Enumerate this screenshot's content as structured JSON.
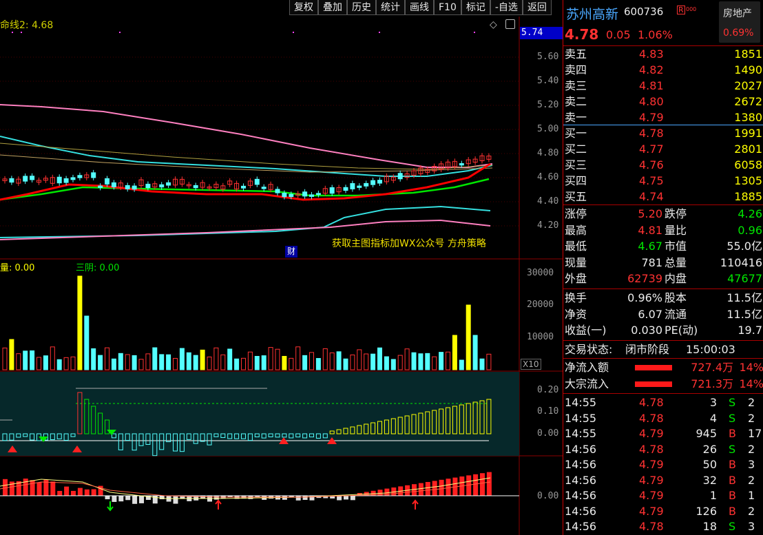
{
  "toolbar": [
    "复权",
    "叠加",
    "历史",
    "统计",
    "画线",
    "F10",
    "标记",
    "-自选",
    "返回"
  ],
  "main_chart": {
    "indicator_label": "命线2: 4.68",
    "current_price_tag": "5.74",
    "y_ticks": [
      "5.60",
      "5.40",
      "5.20",
      "5.00",
      "4.80",
      "4.60",
      "4.40",
      "4.20"
    ],
    "promo_text": "获取主图指标加WX公众号 方舟策略",
    "finance_marker": "财"
  },
  "volume_panel": {
    "label1": "量: 0.00",
    "label2": "三阴: 0.00",
    "y_ticks": [
      "30000",
      "20000",
      "10000"
    ],
    "unit": "X10"
  },
  "indicator_panel": {
    "y_ticks": [
      "0.20",
      "0.10",
      "0.00"
    ]
  },
  "macd_panel": {
    "y_ticks": [
      "0.00"
    ]
  },
  "stock": {
    "name": "苏州高新",
    "code": "600736",
    "rz": "R",
    "sector": "房地产",
    "sector_change": "0.69%",
    "price": "4.78",
    "change": "0.05",
    "change_pct": "1.06%"
  },
  "asks": [
    {
      "label": "卖五",
      "price": "4.83",
      "vol": "1851"
    },
    {
      "label": "卖四",
      "price": "4.82",
      "vol": "1490"
    },
    {
      "label": "卖三",
      "price": "4.81",
      "vol": "2027"
    },
    {
      "label": "卖二",
      "price": "4.80",
      "vol": "2672"
    },
    {
      "label": "卖一",
      "price": "4.79",
      "vol": "1380"
    }
  ],
  "bids": [
    {
      "label": "买一",
      "price": "4.78",
      "vol": "1991"
    },
    {
      "label": "买二",
      "price": "4.77",
      "vol": "2801"
    },
    {
      "label": "买三",
      "price": "4.76",
      "vol": "6058"
    },
    {
      "label": "买四",
      "price": "4.75",
      "vol": "1305"
    },
    {
      "label": "买五",
      "price": "4.74",
      "vol": "1885"
    }
  ],
  "stats1": [
    {
      "l1": "涨停",
      "v1": "5.20",
      "c1": "red",
      "l2": "跌停",
      "v2": "4.26",
      "c2": "grn"
    },
    {
      "l1": "最高",
      "v1": "4.81",
      "c1": "red",
      "l2": "量比",
      "v2": "0.96",
      "c2": "grn"
    },
    {
      "l1": "最低",
      "v1": "4.67",
      "c1": "grn",
      "l2": "市值",
      "v2": "55.0亿",
      "c2": "wht"
    },
    {
      "l1": "现量",
      "v1": "781",
      "c1": "wht",
      "l2": "总量",
      "v2": "110416",
      "c2": "wht"
    },
    {
      "l1": "外盘",
      "v1": "62739",
      "c1": "red",
      "l2": "内盘",
      "v2": "47677",
      "c2": "grn"
    }
  ],
  "stats2": [
    {
      "l1": "换手",
      "v1": "0.96%",
      "l2": "股本",
      "v2": "11.5亿"
    },
    {
      "l1": "净资",
      "v1": "6.07",
      "l2": "流通",
      "v2": "11.5亿"
    },
    {
      "l1": "收益(一)",
      "v1": "0.030",
      "l2": "PE(动)",
      "v2": "19.7"
    }
  ],
  "trade_status": {
    "label": "交易状态:",
    "value": "闭市阶段",
    "time": "15:00:03"
  },
  "flows": [
    {
      "label": "净流入额",
      "value": "727.4万",
      "pct": "14%"
    },
    {
      "label": "大宗流入",
      "value": "721.3万",
      "pct": "14%"
    }
  ],
  "ticks": [
    {
      "time": "14:55",
      "price": "4.78",
      "vol": "3",
      "side": "S",
      "extra": "2"
    },
    {
      "time": "14:55",
      "price": "4.78",
      "vol": "4",
      "side": "S",
      "extra": "2"
    },
    {
      "time": "14:55",
      "price": "4.79",
      "vol": "945",
      "side": "B",
      "extra": "17"
    },
    {
      "time": "14:56",
      "price": "4.78",
      "vol": "26",
      "side": "S",
      "extra": "2"
    },
    {
      "time": "14:56",
      "price": "4.79",
      "vol": "50",
      "side": "B",
      "extra": "3"
    },
    {
      "time": "14:56",
      "price": "4.79",
      "vol": "32",
      "side": "B",
      "extra": "2"
    },
    {
      "time": "14:56",
      "price": "4.79",
      "vol": "1",
      "side": "B",
      "extra": "1"
    },
    {
      "time": "14:56",
      "price": "4.79",
      "vol": "126",
      "side": "B",
      "extra": "2"
    },
    {
      "time": "14:56",
      "price": "4.78",
      "vol": "18",
      "side": "S",
      "extra": "3"
    }
  ],
  "colors": {
    "up": "#ff3232",
    "down": "#54ffff",
    "grid": "#8b0000",
    "ma5": "#ff0000",
    "ma10": "#00e600",
    "ma20": "#35e0e0",
    "ma60": "#ff80c0"
  }
}
